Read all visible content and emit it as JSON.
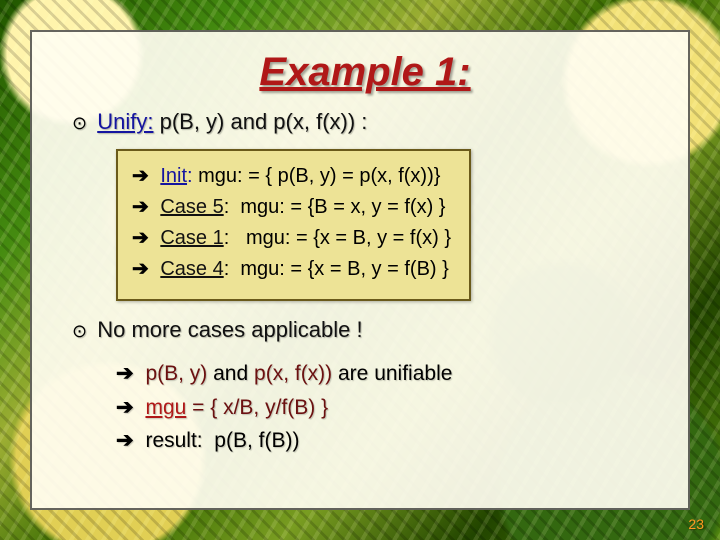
{
  "title": "Example 1:",
  "line1": {
    "label": "Unify:",
    "expr": "p(B, y) and p(x, f(x)) :"
  },
  "box": {
    "init": {
      "label": "Init",
      "rhs": "mgu: = { p(B, y) = p(x, f(x))}"
    },
    "rows": [
      {
        "label": "Case 5",
        "rhs": "mgu: = {B = x, y = f(x) }"
      },
      {
        "label": "Case 1",
        "rhs": "mgu: = {x = B, y = f(x) }"
      },
      {
        "label": "Case 4",
        "rhs": "mgu: = {x = B, y = f(B) }"
      }
    ]
  },
  "line2": "No more cases applicable !",
  "concl": {
    "r1_a": "p(B, y)",
    "r1_mid": " and ",
    "r1_b": "p(x, f(x))",
    "r1_tail": " are unifiable",
    "r2_label": "mgu",
    "r2_rhs": " = { x/B, y/f(B) }",
    "r3": "result:  p(B, f(B))"
  },
  "pagenum": "23"
}
